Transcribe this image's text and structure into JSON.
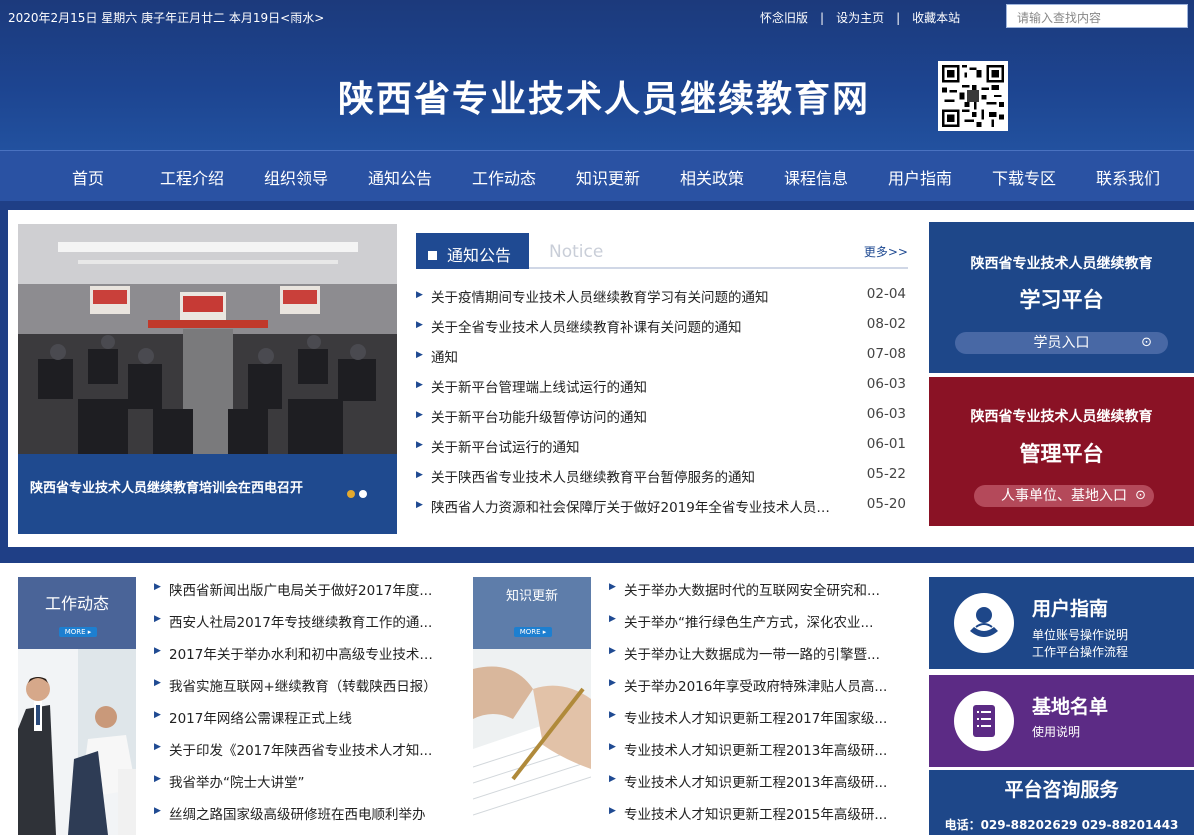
{
  "header": {
    "date_text": "2020年2月15日  星期六  庚子年正月廿二  本月19日<雨水>",
    "links": [
      "怀念旧版",
      "设为主页",
      "收藏本站"
    ],
    "search_placeholder": "请输入查找内容",
    "site_title": "陕西省专业技术人员继续教育网"
  },
  "nav": [
    "首页",
    "工程介绍",
    "组织领导",
    "通知公告",
    "工作动态",
    "知识更新",
    "相关政策",
    "课程信息",
    "用户指南",
    "下载专区",
    "联系我们"
  ],
  "slider": {
    "caption": "陕西省专业技术人员继续教育培训会在西电召开",
    "active_dot_color": "#e3a92e"
  },
  "notice": {
    "tab_label": "通知公告",
    "tab_en": "Notice",
    "more_label": "更多>>",
    "items": [
      {
        "title": "关于疫情期间专业技术人员继续教育学习有关问题的通知",
        "date": "02-04"
      },
      {
        "title": "关于全省专业技术人员继续教育补课有关问题的通知",
        "date": "08-02"
      },
      {
        "title": "通知",
        "date": "07-08"
      },
      {
        "title": "关于新平台管理端上线试运行的通知",
        "date": "06-03"
      },
      {
        "title": "关于新平台功能升级暂停访问的通知",
        "date": "06-03"
      },
      {
        "title": "关于新平台试运行的通知",
        "date": "06-01"
      },
      {
        "title": "关于陕西省专业技术人员继续教育平台暂停服务的通知",
        "date": "05-22"
      },
      {
        "title": "陕西省人力资源和社会保障厅关于做好2019年全省专业技术人员继续教育工作的通知",
        "date": "05-20"
      }
    ]
  },
  "platforms": {
    "learning": {
      "line1": "陕西省专业技术人员继续教育",
      "line2": "学习平台",
      "button": "学员入口"
    },
    "management": {
      "line1": "陕西省专业技术人员继续教育",
      "line2": "管理平台",
      "button": "人事单位、基地入口"
    }
  },
  "work": {
    "label": "工作动态",
    "more": "MORE",
    "items": [
      "陕西省新闻出版广电局关于做好2017年度...",
      "西安人社局2017年专技继续教育工作的通...",
      "2017年关于举办水利和初中高级专业技术人...",
      "我省实施互联网+继续教育（转载陕西日报）",
      "2017年网络公需课程正式上线",
      "关于印发《2017年陕西省专业技术人才知...",
      "我省举办“院士大讲堂”",
      "丝绸之路国家级高级研修班在西电顺利举办"
    ]
  },
  "knowledge": {
    "label": "知识更新",
    "more": "MORE",
    "items": [
      "关于举办大数据时代的互联网安全研究和...",
      "关于举办“推行绿色生产方式，深化农业...",
      "关于举办让大数据成为一带一路的引擎暨...",
      "关于举办2016年享受政府特殊津贴人员高...",
      "专业技术人才知识更新工程2017年国家级...",
      "专业技术人才知识更新工程2013年高级研...",
      "专业技术人才知识更新工程2013年高级研...",
      "专业技术人才知识更新工程2015年高级研..."
    ]
  },
  "guide": {
    "title": "用户指南",
    "line1": "单位账号操作说明",
    "line2": "工作平台操作流程"
  },
  "base": {
    "title": "基地名单",
    "line1": "使用说明"
  },
  "consult": {
    "title": "平台咨询服务",
    "phone": "电话：029-88202629  029-88201443"
  }
}
